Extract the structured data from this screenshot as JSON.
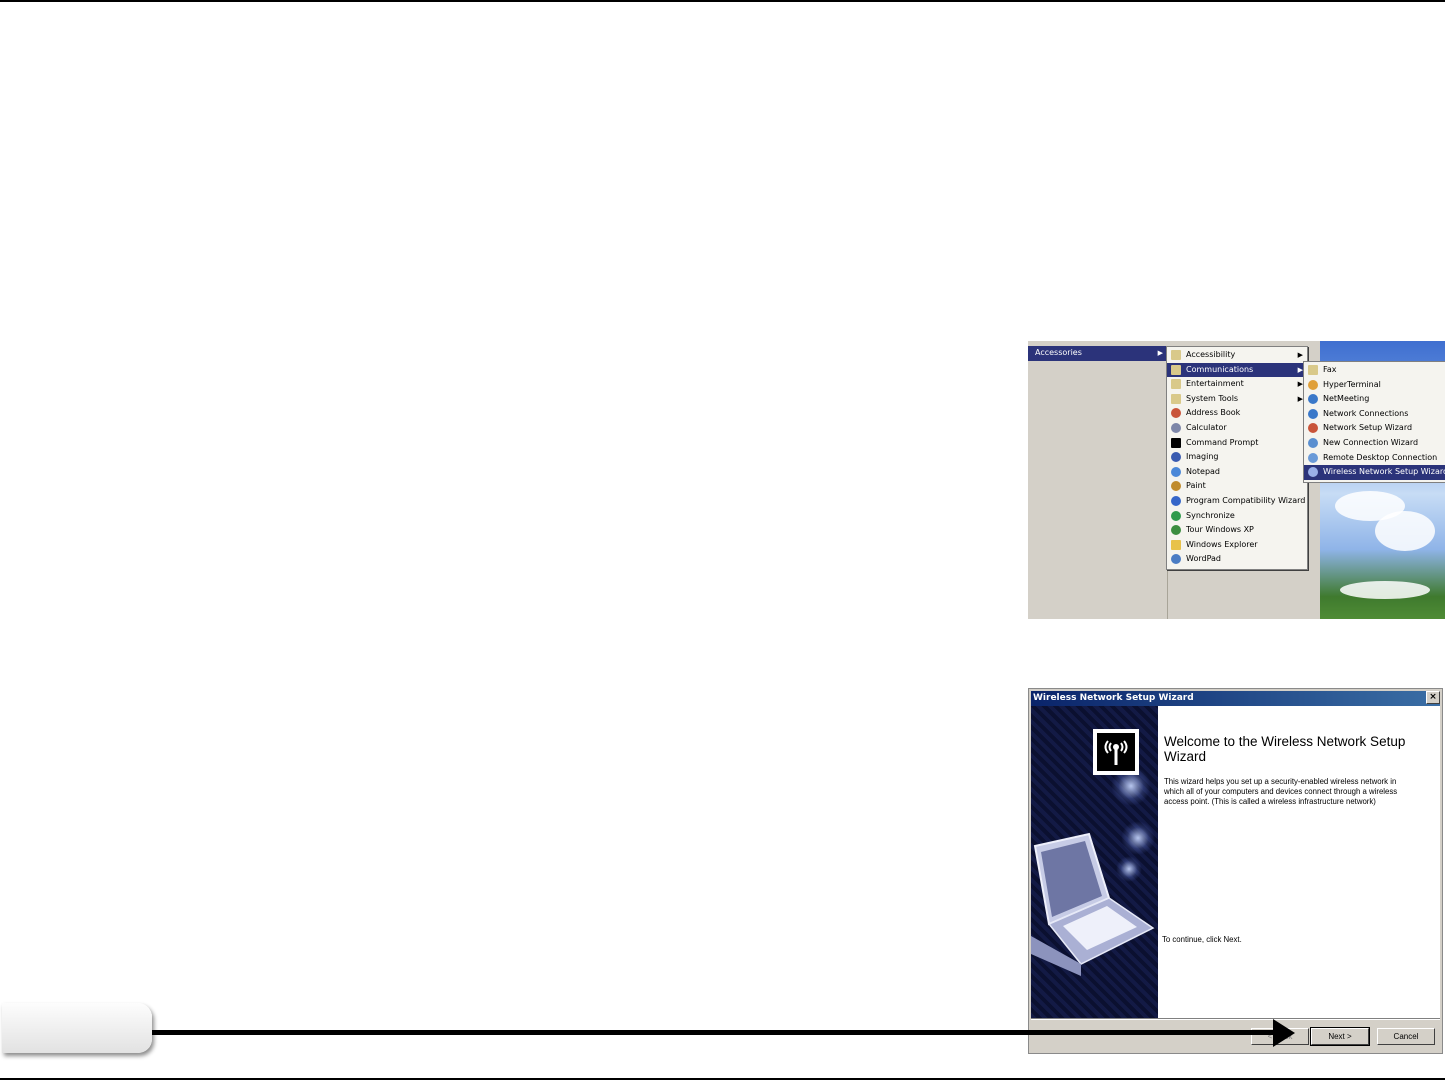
{
  "menu_screenshot": {
    "accessories_menu": {
      "label": "Accessories"
    },
    "accessories_items": [
      {
        "label": "Accessibility",
        "icon": "program-group-icon",
        "submenu": true
      },
      {
        "label": "Communications",
        "icon": "program-group-icon",
        "submenu": true,
        "selected": true
      },
      {
        "label": "Entertainment",
        "icon": "program-group-icon",
        "submenu": true
      },
      {
        "label": "System Tools",
        "icon": "program-group-icon",
        "submenu": true
      },
      {
        "label": "Address Book",
        "icon": "address-book-icon"
      },
      {
        "label": "Calculator",
        "icon": "calculator-icon"
      },
      {
        "label": "Command Prompt",
        "icon": "command-prompt-icon"
      },
      {
        "label": "Imaging",
        "icon": "imaging-icon"
      },
      {
        "label": "Notepad",
        "icon": "notepad-icon"
      },
      {
        "label": "Paint",
        "icon": "paint-icon"
      },
      {
        "label": "Program Compatibility Wizard",
        "icon": "compatibility-wizard-icon"
      },
      {
        "label": "Synchronize",
        "icon": "synchronize-icon"
      },
      {
        "label": "Tour Windows XP",
        "icon": "tour-icon"
      },
      {
        "label": "Windows Explorer",
        "icon": "folder-icon"
      },
      {
        "label": "WordPad",
        "icon": "wordpad-icon"
      }
    ],
    "communications_items": [
      {
        "label": "Fax",
        "icon": "program-group-icon"
      },
      {
        "label": "HyperTerminal",
        "icon": "hyperterminal-icon"
      },
      {
        "label": "NetMeeting",
        "icon": "netmeeting-icon"
      },
      {
        "label": "Network Connections",
        "icon": "network-connections-icon"
      },
      {
        "label": "Network Setup Wizard",
        "icon": "network-setup-wizard-icon"
      },
      {
        "label": "New Connection Wizard",
        "icon": "new-connection-wizard-icon"
      },
      {
        "label": "Remote Desktop Connection",
        "icon": "remote-desktop-icon"
      },
      {
        "label": "Wireless Network Setup Wizard",
        "icon": "wireless-wizard-icon",
        "selected": true
      }
    ],
    "colors": {
      "highlight": "#2b337a",
      "menu_bg": "#f5f4ef"
    }
  },
  "wizard": {
    "title": "Wireless Network Setup Wizard",
    "close": "×",
    "heading": "Welcome to the Wireless Network Setup Wizard",
    "body": "This wizard helps you set up a security-enabled wireless network in which all of your computers and devices connect through a wireless access point. (This is called a wireless infrastructure network)",
    "continue_text": "To continue, click Next.",
    "buttons": {
      "back": "< Back",
      "next": "Next >",
      "cancel": "Cancel"
    },
    "side_icons": [
      "antenna-icon",
      "laptop-icon"
    ]
  },
  "callout": {
    "arrow": "arrow-right-icon"
  }
}
